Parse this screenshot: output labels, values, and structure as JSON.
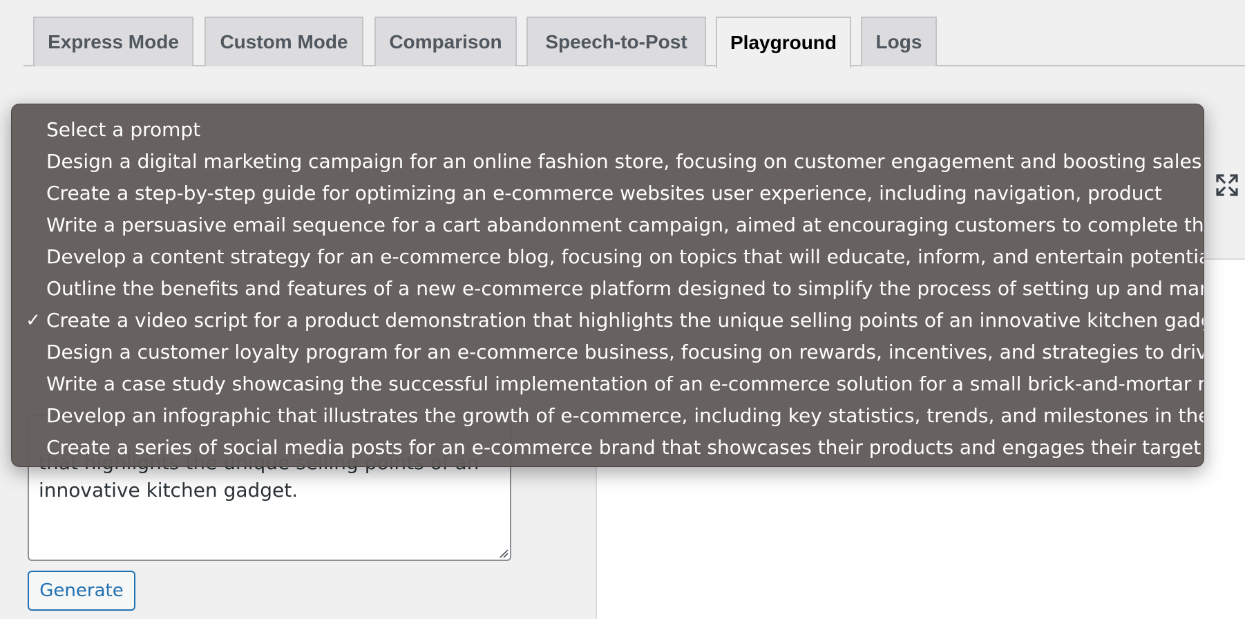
{
  "tabs": [
    {
      "label": "Express Mode",
      "active": false
    },
    {
      "label": "Custom Mode",
      "active": false
    },
    {
      "label": "Comparison",
      "active": false
    },
    {
      "label": "Speech-to-Post",
      "active": false
    },
    {
      "label": "Playground",
      "active": true
    },
    {
      "label": "Logs",
      "active": false
    }
  ],
  "prompt_select": {
    "selected_index": 6,
    "options": [
      "Select a prompt",
      "Design a digital marketing campaign for an online fashion store, focusing on customer engagement and boosting sales.",
      "Create a step-by-step guide for optimizing an e-commerce websites user experience, including navigation, product",
      "Write a persuasive email sequence for a cart abandonment campaign, aimed at encouraging customers to complete their",
      "Develop a content strategy for an e-commerce blog, focusing on topics that will educate, inform, and entertain potential",
      "Outline the benefits and features of a new e-commerce platform designed to simplify the process of setting up and managing an",
      "Create a video script for a product demonstration that highlights the unique selling points of an innovative kitchen gadget.",
      "Design a customer loyalty program for an e-commerce business, focusing on rewards, incentives, and strategies to drive repeat",
      "Write a case study showcasing the successful implementation of an e-commerce solution for a small brick-and-mortar retailer.",
      "Develop an infographic that illustrates the growth of e-commerce, including key statistics, trends, and milestones in the",
      "Create a series of social media posts for an e-commerce brand that showcases their products and engages their target"
    ],
    "checkmark": "✓"
  },
  "prompt_textarea": {
    "visible_text": "that highlights the unique selling points of an innovative kitchen gadget."
  },
  "generate_label": "Generate",
  "colors": {
    "accent": "#2271b1",
    "dropdown_bg": "#625c5a",
    "tab_bg": "#dcdcde",
    "page_bg": "#f0f0f1"
  },
  "icons": {
    "fullscreen": "fullscreen-icon",
    "resize": "resize-handle-icon",
    "check": "checkmark-icon"
  }
}
